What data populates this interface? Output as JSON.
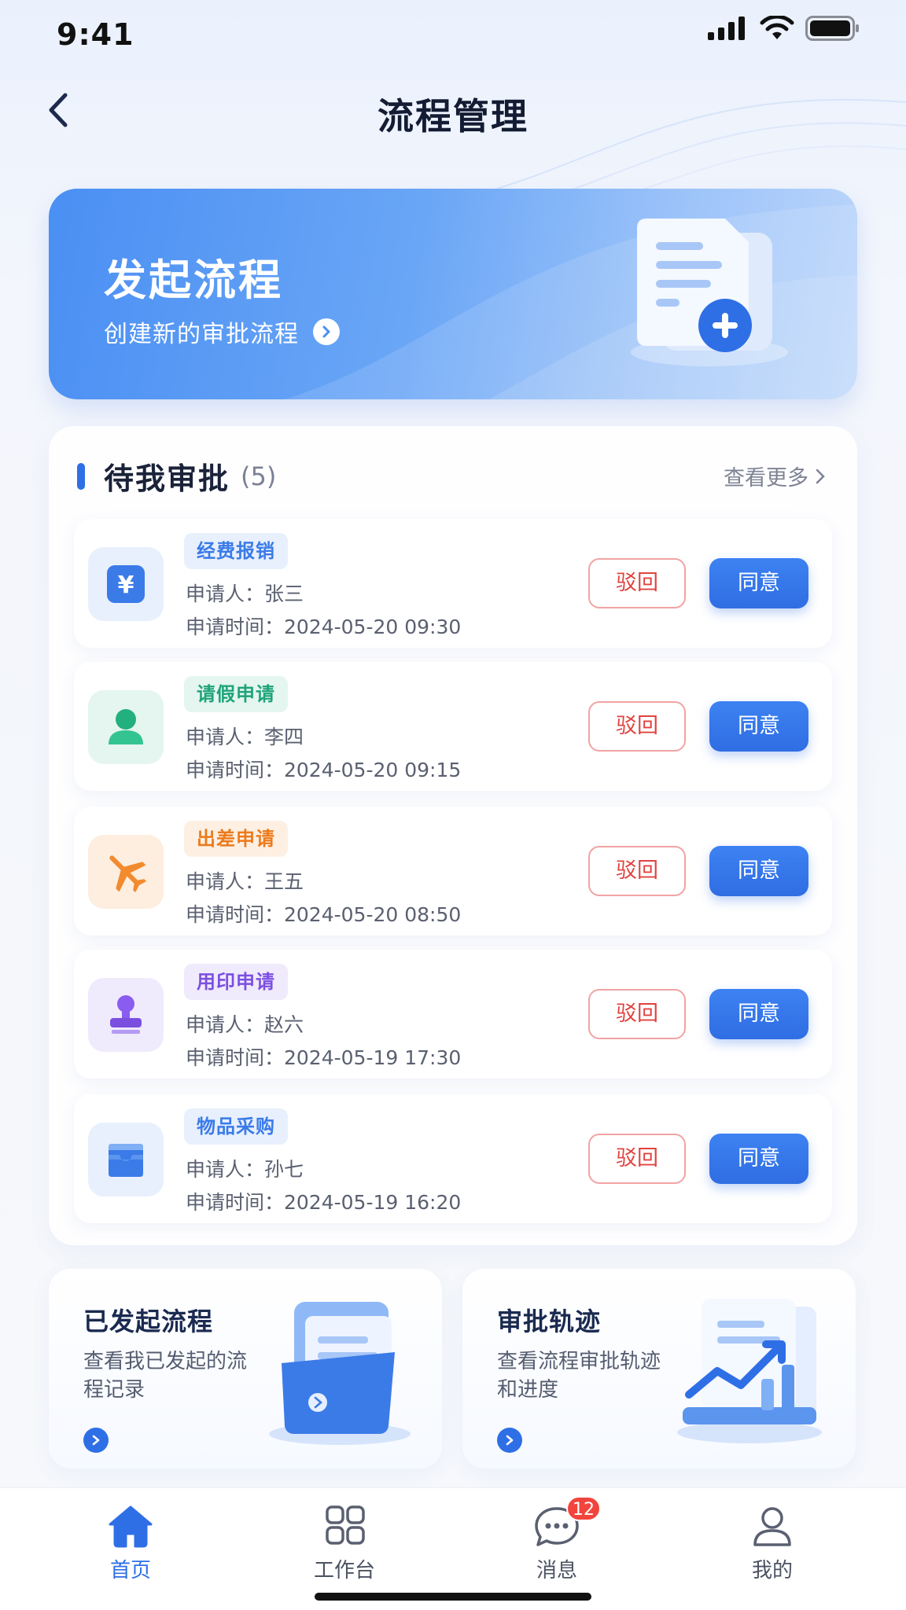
{
  "status_bar": {
    "time": "9:41"
  },
  "nav": {
    "title": "流程管理"
  },
  "banner": {
    "title": "发起流程",
    "subtitle": "创建新的审批流程"
  },
  "pending": {
    "title": "待我审批",
    "count": "(5)",
    "more": "查看更多",
    "items": [
      {
        "tag": "经费报销",
        "tag_color": "#3b7be8",
        "tag_bg": "#e8f0fd",
        "applicant": "申请人：张三",
        "time": "申请时间：2024-05-20 09:30",
        "icon": "yuan-icon",
        "reject": "驳回",
        "agree": "同意"
      },
      {
        "tag": "请假申请",
        "tag_color": "#1fa37a",
        "tag_bg": "#e4f6ef",
        "applicant": "申请人：李四",
        "time": "申请时间：2024-05-20 09:15",
        "icon": "person-icon",
        "reject": "驳回",
        "agree": "同意"
      },
      {
        "tag": "出差申请",
        "tag_color": "#ec7a1c",
        "tag_bg": "#fdf0e3",
        "applicant": "申请人：王五",
        "time": "申请时间：2024-05-20 08:50",
        "icon": "airplane-icon",
        "reject": "驳回",
        "agree": "同意"
      },
      {
        "tag": "用印申请",
        "tag_color": "#7b4fe0",
        "tag_bg": "#f0eafd",
        "applicant": "申请人：赵六",
        "time": "申请时间：2024-05-19 17:30",
        "icon": "stamp-icon",
        "reject": "驳回",
        "agree": "同意"
      },
      {
        "tag": "物品采购",
        "tag_color": "#3b7be8",
        "tag_bg": "#e8f0fd",
        "applicant": "申请人：孙七",
        "time": "申请时间：2024-05-19 16:20",
        "icon": "box-icon",
        "reject": "驳回",
        "agree": "同意"
      }
    ]
  },
  "cards": [
    {
      "title": "已发起流程",
      "desc": "查看我已发起的流程记录"
    },
    {
      "title": "审批轨迹",
      "desc": "查看流程审批轨迹和进度"
    }
  ],
  "tabs": [
    {
      "label": "首页",
      "active": true
    },
    {
      "label": "工作台"
    },
    {
      "label": "消息",
      "badge": "12"
    },
    {
      "label": "我的"
    }
  ],
  "colors": {
    "primary": "#2f6fe6",
    "danger": "#e0433f"
  }
}
